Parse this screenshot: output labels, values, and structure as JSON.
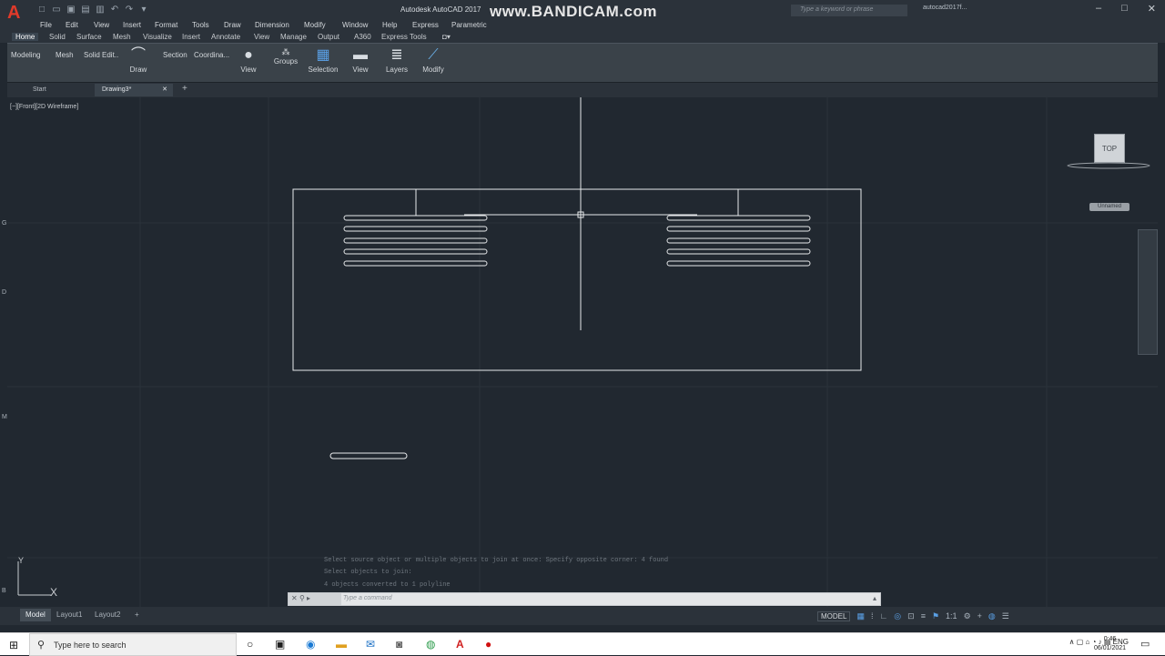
{
  "title_bar": {
    "logo": "A",
    "app_title": "Autodesk AutoCAD 2017",
    "watermark": "www.BANDICAM.com",
    "search_placeholder": "Type a keyword or phrase",
    "user": "autocad2017f..."
  },
  "menu": [
    "File",
    "Edit",
    "View",
    "Insert",
    "Format",
    "Tools",
    "Draw",
    "Dimension",
    "Modify",
    "Window",
    "Help",
    "Express",
    "Parametric"
  ],
  "ribbon_tabs": [
    "Home",
    "Solid",
    "Surface",
    "Mesh",
    "Visualize",
    "Insert",
    "Annotate",
    "View",
    "Manage",
    "Output",
    "A360",
    "Express Tools"
  ],
  "ribbon_panels": {
    "small": [
      "Modeling",
      "Mesh",
      "Solid Edit..",
      "Section",
      "Coordina..."
    ],
    "draw": "Draw",
    "view": "View",
    "groups": "Groups",
    "selection": "Selection",
    "view2": "View",
    "layers": "Layers",
    "modify": "Modify"
  },
  "file_tabs": [
    "Start",
    "Drawing3*"
  ],
  "viewport": {
    "label": "[−][Front][2D Wireframe]",
    "viewcube": "TOP",
    "ucs_badge": "Unnamed",
    "ucs_y": "Y",
    "ucs_x": "X",
    "side_letters": [
      "G",
      "D",
      "M",
      "B"
    ]
  },
  "command_history": [
    "Select source object or multiple objects to join at once: Specify opposite corner: 4 found",
    "Select objects to join:",
    "4 objects converted to 1 polyline"
  ],
  "command_placeholder": "Type a command",
  "layout_tabs": [
    "Model",
    "Layout1",
    "Layout2"
  ],
  "status": {
    "model": "MODEL",
    "scale": "1:1"
  },
  "taskbar": {
    "search_placeholder": "Type here to search",
    "lang": "ENG",
    "time": "0:46",
    "date": "06/01/2021"
  }
}
